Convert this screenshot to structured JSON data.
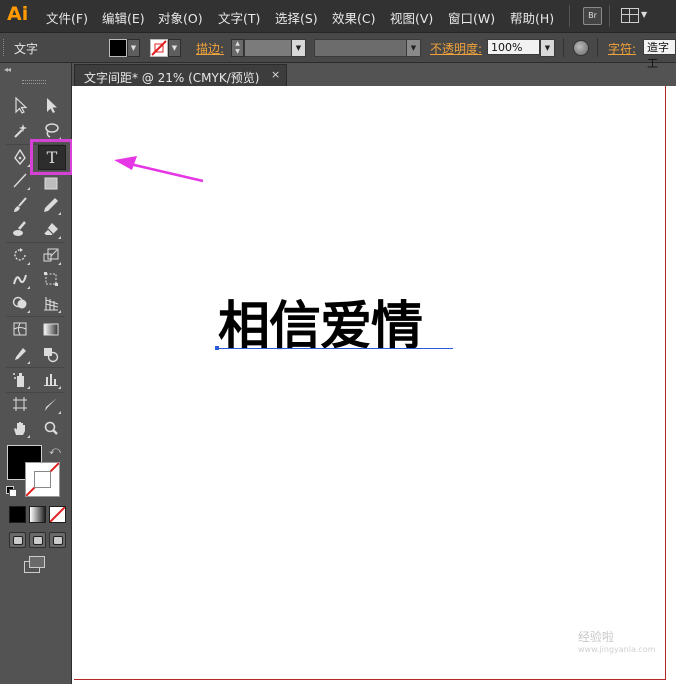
{
  "app": {
    "logo": "Ai"
  },
  "menu": [
    "文件(F)",
    "编辑(E)",
    "对象(O)",
    "文字(T)",
    "选择(S)",
    "效果(C)",
    "视图(V)",
    "窗口(W)",
    "帮助(H)"
  ],
  "menubar_buttons": {
    "bridge_label": "Br",
    "workspace_icon": "workspace-grid-icon"
  },
  "control_bar": {
    "tool_name": "文字",
    "stroke_label": "描边:",
    "opacity_label": "不透明度:",
    "opacity_value": "100%",
    "char_label": "字符:",
    "font_value": "造字工"
  },
  "document": {
    "tab_title": "文字间距* @ 21% (CMYK/预览)",
    "close_glyph": "×",
    "artwork_text": "相信爱情"
  },
  "tools": [
    "selection-tool",
    "direct-selection-tool",
    "magic-wand-tool",
    "lasso-tool",
    "pen-tool",
    "type-tool",
    "line-tool",
    "rectangle-tool",
    "paintbrush-tool",
    "pencil-tool",
    "blob-brush-tool",
    "eraser-tool",
    "rotate-tool",
    "scale-tool",
    "warp-tool",
    "free-transform-tool",
    "shape-builder-tool",
    "perspective-grid-tool",
    "mesh-tool",
    "gradient-tool",
    "eyedropper-tool",
    "blend-tool",
    "symbol-sprayer-tool",
    "column-graph-tool",
    "artboard-tool",
    "slice-tool",
    "hand-tool",
    "zoom-tool"
  ],
  "type_tool_glyph": "T",
  "colors": {
    "fill": "#000000",
    "stroke": "none",
    "highlight": "#d642d6",
    "arrow": "#e636e6",
    "logo": "#ff9a00"
  },
  "watermark": {
    "name": "经验啦",
    "url": "www.jingyanla.com"
  }
}
